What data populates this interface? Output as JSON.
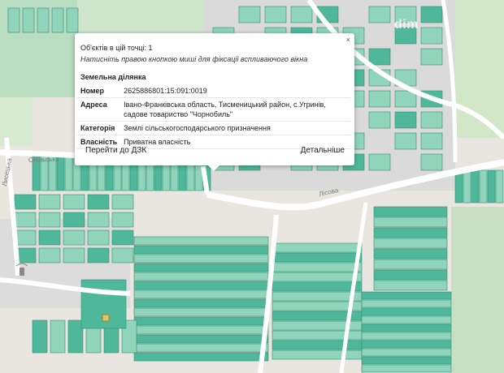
{
  "popup": {
    "count": "Об'єктів в цій точці: 1",
    "hint": "Натисніть правою кнопкою миші для фіксації вспливаючого вікна",
    "section": "Земельна ділянка",
    "rows": [
      {
        "key": "Номер",
        "value": "2625886801:15:091:0019"
      },
      {
        "key": "Адреса",
        "value": "Івано-Франківська область, Тисменицький район, с.Угринів, садове товариство \"Чорнобиль\""
      },
      {
        "key": "Категорія",
        "value": "Землі сільськогосподарського призначення"
      },
      {
        "key": "Власність",
        "value": "Приватна власність"
      }
    ],
    "link_left": "Перейти до ДЗК",
    "link_right": "Детальніше",
    "close": "×"
  },
  "watermark": {
    "text": "dim"
  },
  "streets": {
    "left": "Лисецька",
    "mid": "Опільська",
    "right": "Лісова"
  },
  "colors": {
    "parcel_dark": "#4fb89a",
    "parcel_light": "#8fd4bb",
    "land": "#eceae2",
    "road": "#ffffff"
  }
}
